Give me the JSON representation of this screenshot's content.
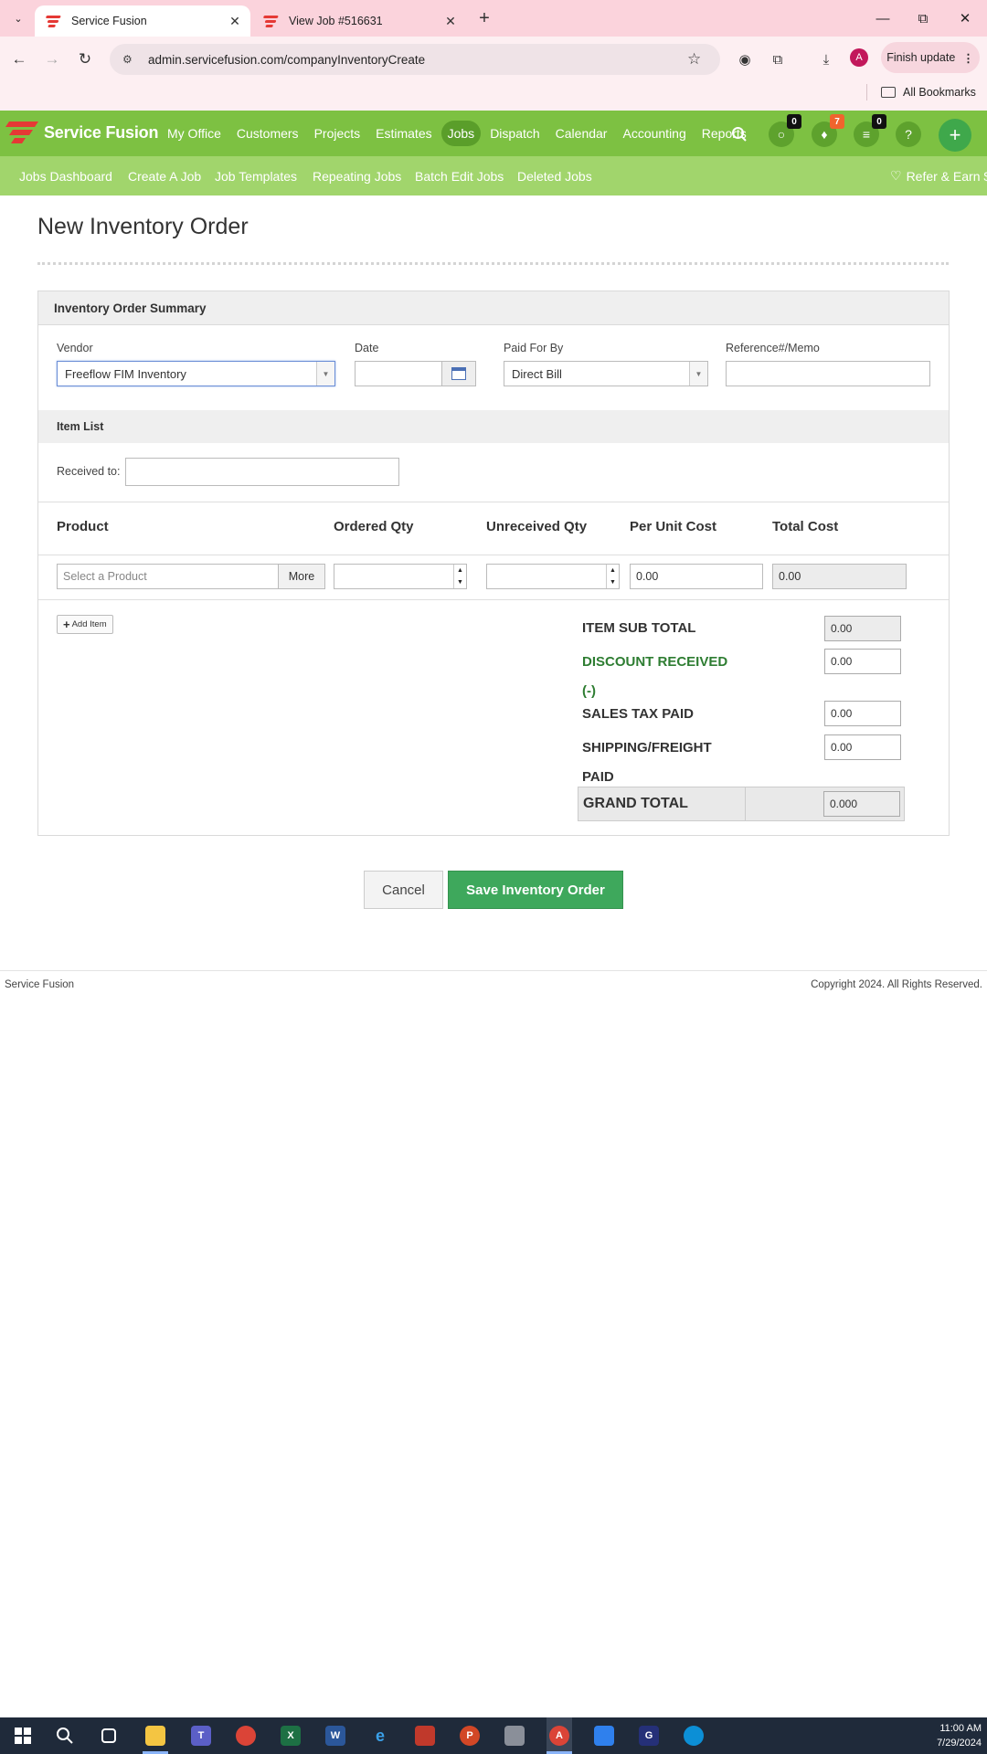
{
  "browser": {
    "tabs": [
      {
        "title": "Service Fusion",
        "active": true
      },
      {
        "title": "View Job #516631",
        "active": false
      }
    ],
    "url": "admin.servicefusion.com/companyInventoryCreate",
    "finish_update_label": "Finish update",
    "profile_initial": "A",
    "bookmarks_label": "All Bookmarks"
  },
  "app": {
    "brand": "Service Fusion",
    "nav": [
      "My Office",
      "Customers",
      "Projects",
      "Estimates",
      "Jobs",
      "Dispatch",
      "Calendar",
      "Accounting",
      "Reports"
    ],
    "active_nav": "Jobs",
    "badges": {
      "chat": "0",
      "notifications": "7",
      "tasks": "0"
    },
    "help_label": "?",
    "subnav": [
      "Jobs Dashboard",
      "Create A Job",
      "Job Templates",
      "Repeating Jobs",
      "Batch Edit Jobs",
      "Deleted Jobs"
    ],
    "refer_label": "Refer & Earn $"
  },
  "page": {
    "title": "New Inventory Order",
    "summary_header": "Inventory Order Summary",
    "vendor_label": "Vendor",
    "vendor_value": "Freeflow FIM Inventory",
    "date_label": "Date",
    "date_value": "",
    "paid_for_by_label": "Paid For By",
    "paid_for_by_value": "Direct Bill",
    "reference_label": "Reference#/Memo",
    "reference_value": "",
    "item_list_header": "Item List",
    "received_to_label": "Received to:",
    "received_to_value": "",
    "columns": [
      "Product",
      "Ordered Qty",
      "Unreceived Qty",
      "Per Unit Cost",
      "Total Cost"
    ],
    "row": {
      "product_placeholder": "Select a Product",
      "more_label": "More",
      "ordered_qty": "",
      "unreceived_qty": "",
      "per_unit_cost": "0.00",
      "total_cost": "0.00"
    },
    "add_item_label": "Add Item",
    "totals": {
      "item_sub_total_label": "ITEM SUB TOTAL",
      "item_sub_total": "0.00",
      "discount_label_1": "DISCOUNT RECEIVED",
      "discount_label_2": "(-)",
      "discount": "0.00",
      "sales_tax_label": "SALES TAX PAID",
      "sales_tax": "0.00",
      "shipping_label_1": "SHIPPING/FREIGHT",
      "shipping_label_2": "PAID",
      "shipping": "0.00",
      "grand_total_label": "GRAND TOTAL",
      "grand_total": "0.000"
    },
    "cancel_label": "Cancel",
    "save_label": "Save Inventory Order"
  },
  "footer": {
    "left": "Service Fusion",
    "right": "Copyright 2024. All Rights Reserved."
  },
  "taskbar": {
    "time": "11:00 AM",
    "date": "7/29/2024"
  },
  "colors": {
    "nav_green": "#7dc142",
    "subnav_green": "#a1d56c",
    "save_green": "#3ea85c",
    "discount_green": "#2e7d32",
    "tab_strip": "#fbd3dc"
  }
}
